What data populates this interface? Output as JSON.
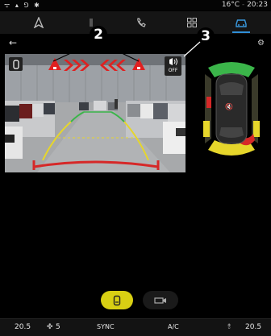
{
  "status_bar": {
    "left_icons": "ᯤ ▴ ⅁ ✱",
    "temperature": "16°C",
    "time": "20:23"
  },
  "nav": {
    "items": [
      "navigation-icon",
      "media-icon",
      "phone-icon",
      "apps-icon",
      "vehicle-icon"
    ],
    "active": "vehicle-icon"
  },
  "subheader": {
    "back_symbol": "←",
    "gear_symbol": "⚙"
  },
  "camera": {
    "callouts": [
      "2",
      "2",
      "3"
    ],
    "off_label": "OFF",
    "warning_color": "#e02020",
    "guide_colors": {
      "far": "#3bb54a",
      "mid": "#e6d62b",
      "near": "#d62828"
    }
  },
  "overhead": {
    "mute_symbol": "🔇",
    "zone_colors": {
      "front": "#3bb54a",
      "side": "#e6d62b",
      "alert": "#d62828"
    }
  },
  "view_toggle": {
    "rear_icon": "rear-camera-icon",
    "surround_icon": "camera-icon",
    "active_color": "#d8cf13"
  },
  "climate": {
    "left_temp": "20.5",
    "fan_level": "5",
    "sync_label": "SYNC",
    "ac_label": "A/C",
    "right_temp": "20.5"
  }
}
